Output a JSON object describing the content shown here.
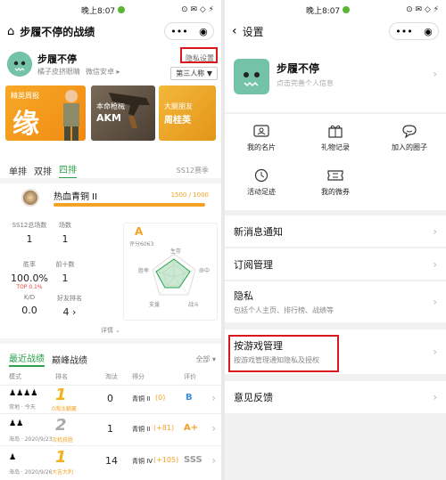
{
  "left": {
    "status": {
      "time": "晚上8:07",
      "icons_right": "⊙ ✉ ◇ ⚡"
    },
    "header": {
      "title": "步履不停的战绩"
    },
    "profile": {
      "name": "步履不停",
      "sub1": "橘子皮挤眼睛",
      "sub2": "微信安卓 ▸",
      "privacy": "隐私设置",
      "view": "第三人称 ▼"
    },
    "cards": [
      {
        "title": "精英周报",
        "big": "缘"
      },
      {
        "title": "本命枪械",
        "big": "AKM"
      },
      {
        "title": "大腿朋友",
        "big": "周桂英"
      }
    ],
    "tabs": {
      "items": [
        "单排",
        "双排",
        "四排"
      ],
      "active": "四排",
      "season": "SS12赛季"
    },
    "rank": {
      "name": "热血青铜 II",
      "progress_text": "1500 / 1000",
      "progress": 1.0
    },
    "stats": [
      {
        "label": "SS12总场数",
        "value": "1"
      },
      {
        "label": "场数",
        "value": "1"
      },
      {
        "label": "胜率",
        "value": "100.0%",
        "sub": "TOP 0.1%"
      },
      {
        "label": "前十数",
        "value": "1"
      },
      {
        "label": "K/D",
        "value": "0.0"
      },
      {
        "label": "好友排名",
        "value": "4 ›"
      }
    ],
    "grade": {
      "letter": "A",
      "score": "评分6063"
    },
    "radar_labels": [
      "生存",
      "命中",
      "战斗",
      "支援",
      "胜率"
    ],
    "details": "详情 ⌄",
    "battles_tabs": {
      "recent": "最近战绩",
      "peak": "巅峰战绩",
      "filter": "全部 ▾"
    },
    "battle_headers": [
      "模式",
      "排名",
      "淘汰",
      "得分",
      "评价"
    ],
    "battles": [
      {
        "mode": "四排",
        "meta": "常地 · 今天",
        "rank": "1",
        "rank_note": "0淘汰躺赢",
        "kills": "0",
        "tier": "青铜 II",
        "delta": "(0)",
        "grade": "B"
      },
      {
        "mode": "四排",
        "meta": "海岛 · 2020/9/23",
        "rank": "2",
        "rank_note": "次机获胜",
        "kills": "1",
        "tier": "青铜 II",
        "delta": "(+81)",
        "grade": "A+"
      },
      {
        "mode": "单排",
        "meta": "海岛 · 2020/9/26",
        "rank": "1",
        "rank_note": "大吉大利",
        "kills": "14",
        "tier": "青铜 IV",
        "delta": "(+105)",
        "grade": "SSS"
      }
    ]
  },
  "right": {
    "status": {
      "time": "晚上8:07"
    },
    "header": {
      "title": "设置"
    },
    "profile": {
      "name": "步履不停",
      "sub": "点击完善个人信息"
    },
    "grid": [
      {
        "icon": "id-card-icon",
        "label": "我的名片"
      },
      {
        "icon": "gift-icon",
        "label": "礼物记录"
      },
      {
        "icon": "chat-icon",
        "label": "加入的圈子"
      },
      {
        "icon": "clock-icon",
        "label": "活动足迹"
      },
      {
        "icon": "ticket-icon",
        "label": "我的微券"
      }
    ],
    "menu": [
      {
        "title": "新消息通知",
        "sub": ""
      },
      {
        "title": "订阅管理",
        "sub": ""
      },
      {
        "title": "隐私",
        "sub": "包括个人主页、排行榜、战绩等"
      },
      {
        "title": "按游戏管理",
        "sub": "按游戏管理通知隐私及授权"
      },
      {
        "title": "意见反馈",
        "sub": ""
      }
    ]
  },
  "colors": {
    "accent_green": "#2aa24b",
    "highlight_red": "#d7191e",
    "gold": "#f3a223"
  }
}
